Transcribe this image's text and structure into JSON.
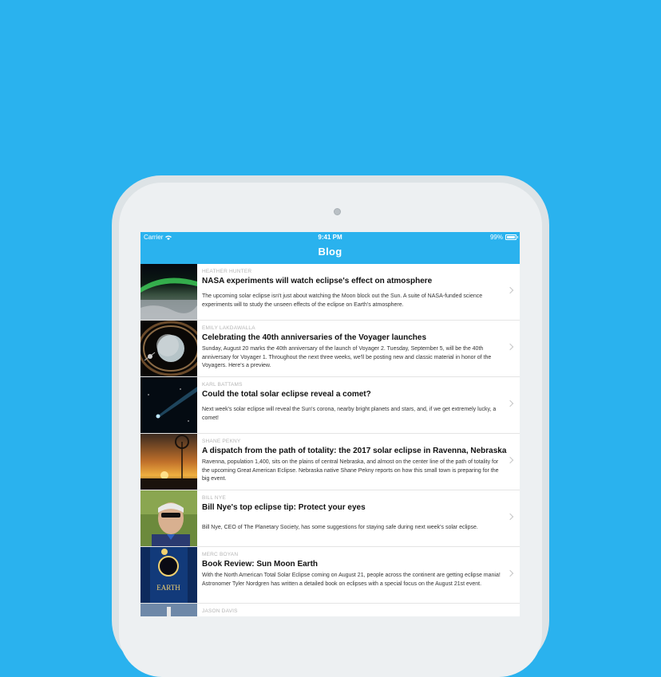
{
  "status_bar": {
    "carrier": "Carrier",
    "time": "9:41 PM",
    "battery": "99%"
  },
  "nav": {
    "title": "Blog"
  },
  "posts": [
    {
      "author": "HEATHER HUNTER",
      "title": "NASA experiments will watch eclipse's effect on atmosphere",
      "summary": "The upcoming solar eclipse isn't just about watching the Moon block out the Sun. A suite of NASA-funded science experiments will to study the unseen effects of the eclipse on Earth's atmosphere."
    },
    {
      "author": "EMILY LAKDAWALLA",
      "title": "Celebrating the 40th anniversaries of the Voyager launches",
      "summary": "Sunday, August 20 marks the 40th anniversary of the launch of Voyager 2. Tuesday, September 5, will be the 40th anniversary for Voyager 1. Throughout the next three weeks, we'll be posting new and classic material in honor of the Voyagers. Here's a preview."
    },
    {
      "author": "KARL BATTAMS",
      "title": "Could the total solar eclipse reveal a comet?",
      "summary": "Next week's solar eclipse will reveal the Sun's corona, nearby bright planets and stars, and, if we get extremely lucky, a comet!"
    },
    {
      "author": "SHANE PEKNY",
      "title": "A dispatch from the path of totality: the 2017 solar eclipse in Ravenna, Nebraska",
      "summary": "Ravenna, population 1,400, sits on the plains of central Nebraska, and almost on the center line of the path of totality for the upcoming Great American Eclipse. Nebraska native Shane Pekny reports on how this small town is preparing for the big event."
    },
    {
      "author": "BILL NYE",
      "title": "Bill Nye's top eclipse tip: Protect your eyes",
      "summary": "Bill Nye, CEO of The Planetary Society, has some suggestions for staying safe during next week's solar eclipse."
    },
    {
      "author": "MERC BOYAN",
      "title": "Book Review: Sun Moon Earth",
      "summary": "With the North American Total Solar Eclipse coming on August 21, people across the continent are getting eclipse mania! Astronomer Tyler Nordgren has written a detailed book on eclipses with a special focus on the August 21st event.",
      "cover_word": "EARTH"
    },
    {
      "author": "JASON DAVIS",
      "title": "",
      "summary": ""
    }
  ]
}
